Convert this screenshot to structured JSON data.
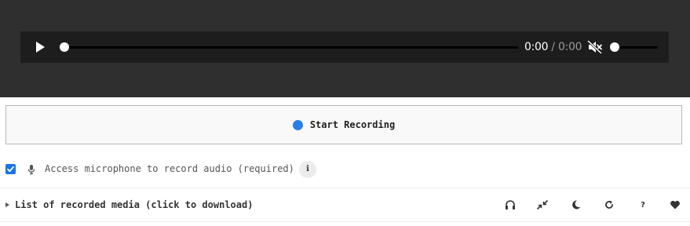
{
  "player": {
    "current_time": "0:00",
    "separator": " / ",
    "duration": "0:00",
    "progress": 0,
    "muted": true,
    "volume": 0,
    "icons": {
      "play": "play-icon",
      "mute": "muted-speaker-icon"
    }
  },
  "recorder": {
    "start_label": "Start Recording",
    "dot_color": "#2b7de9"
  },
  "microphone": {
    "checked": true,
    "label": "Access microphone to record audio (required)",
    "info_glyph": "i",
    "icons": {
      "mic": "microphone-icon",
      "info": "info-icon"
    }
  },
  "media_list": {
    "label": "List of recorded media (click to download)",
    "toolbar": {
      "question_glyph": "?",
      "icons": [
        "headphones-icon",
        "compress-arrows-icon",
        "moon-icon",
        "refresh-icon",
        "question-icon",
        "heart-icon"
      ]
    }
  },
  "colors": {
    "player_background": "#2f2f2f",
    "controls_background": "#1d1d1d",
    "checkbox_accent": "#1a73e8"
  }
}
